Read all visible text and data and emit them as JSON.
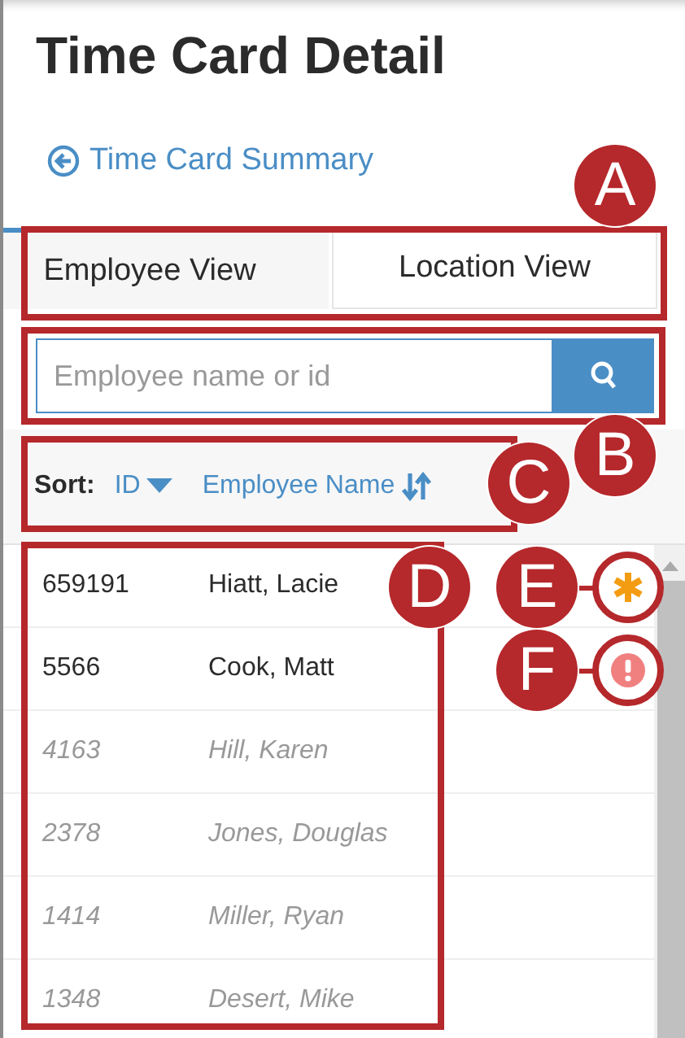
{
  "page": {
    "title": "Time Card Detail",
    "back_link": "Time Card Summary"
  },
  "tabs": [
    {
      "label": "Employee View",
      "selected": true
    },
    {
      "label": "Location View",
      "selected": false
    }
  ],
  "search": {
    "placeholder": "Employee name or id"
  },
  "sort": {
    "label": "Sort:",
    "options": [
      {
        "label": "ID",
        "selected": true
      },
      {
        "label": "Employee Name",
        "selected": false
      }
    ]
  },
  "rows": [
    {
      "id": "659191",
      "name": "Hiatt, Lacie",
      "inactive": false
    },
    {
      "id": "5566",
      "name": "Cook, Matt",
      "inactive": false
    },
    {
      "id": "4163",
      "name": "Hill, Karen",
      "inactive": true
    },
    {
      "id": "2378",
      "name": "Jones, Douglas",
      "inactive": true
    },
    {
      "id": "1414",
      "name": "Miller, Ryan",
      "inactive": true
    },
    {
      "id": "1348",
      "name": "Desert, Mike",
      "inactive": true
    }
  ],
  "callouts": [
    {
      "label": "A",
      "kind": "box"
    },
    {
      "label": "B",
      "kind": "box"
    },
    {
      "label": "C",
      "kind": "box"
    },
    {
      "label": "D",
      "kind": "box"
    },
    {
      "label": "E",
      "kind": "asterisk"
    },
    {
      "label": "F",
      "kind": "alert"
    }
  ]
}
